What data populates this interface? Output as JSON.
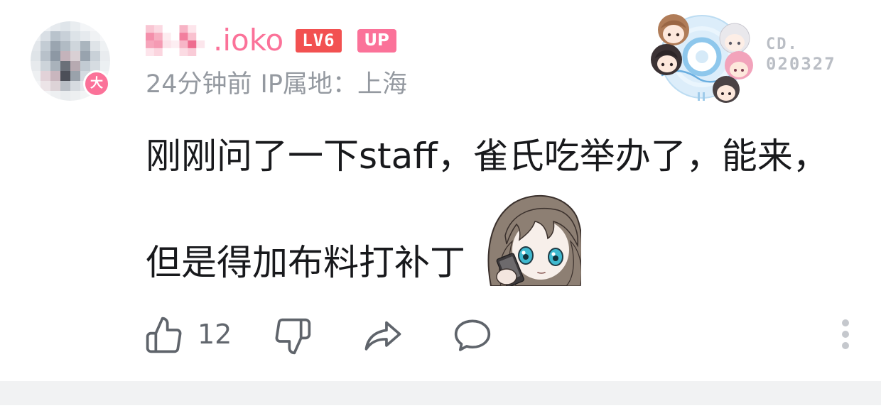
{
  "comment": {
    "user": {
      "name": ".ioko",
      "level": "LV6",
      "up_badge": "UP",
      "avatar_badge": "大"
    },
    "meta": {
      "time": "24分钟前",
      "ip_location": "IP属地：上海"
    },
    "fan_badge": {
      "label": "CD.",
      "number": "020327"
    },
    "content": {
      "lines": [
        "刚刚问了一下staff，雀氏吃举办了，能来，",
        "但是得加布料打补丁"
      ],
      "has_sticker": true
    },
    "actions": {
      "like_count": "12"
    }
  },
  "icons": {
    "like": "like-icon",
    "dislike": "dislike-icon",
    "share": "share-icon",
    "reply": "comment-icon",
    "more": "more-vertical-icon"
  },
  "colors": {
    "accent_pink": "#fb7299",
    "level_red": "#f25151",
    "text": "#18191c",
    "meta_gray": "#9499a0",
    "icon_gray": "#61666d",
    "divider": "#f1f2f3"
  }
}
